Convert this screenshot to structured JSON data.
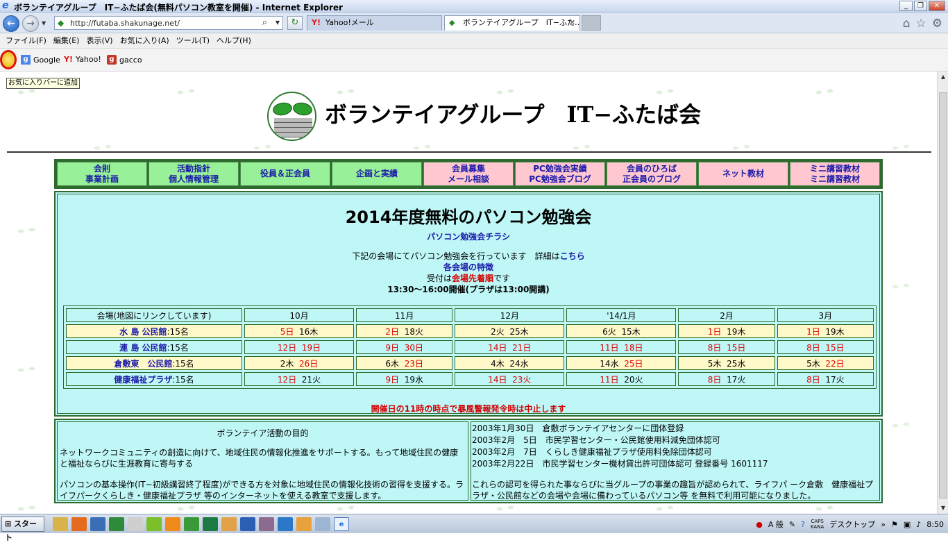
{
  "window": {
    "title": "ボランテイアグループ　IT−ふたば会(無料パソコン教室を開催) - Internet Explorer",
    "buttons": [
      "_",
      "❐",
      "✕"
    ]
  },
  "nav": {
    "back": "←",
    "forward": "→",
    "address": "http://futaba.shakunage.net/",
    "refresh": "↻",
    "tabs": [
      {
        "label": "Yahoo!メール",
        "icon": "Y!"
      },
      {
        "label": "ボランテイアグループ　IT−ふた…",
        "icon": "◆"
      }
    ],
    "tools": [
      "home-icon",
      "star-icon",
      "gear-icon"
    ]
  },
  "menu": [
    "ファイル(F)",
    "編集(E)",
    "表示(V)",
    "お気に入り(A)",
    "ツール(T)",
    "ヘルプ(H)"
  ],
  "favorites": {
    "links": [
      {
        "label": "Google",
        "icon": "g"
      },
      {
        "label": "Yahoo!",
        "icon": "Y!"
      },
      {
        "label": "gacco",
        "icon": "g"
      }
    ],
    "tooltip": "お気に入りバーに追加"
  },
  "site": {
    "title": "ボランテイアグループ　IT−ふたば会",
    "nav": [
      {
        "l1": "会則",
        "l2": "事業計画",
        "color": "green"
      },
      {
        "l1": "活動指針",
        "l2": "個人情報管理",
        "color": "green"
      },
      {
        "l1": "役員＆正会員",
        "l2": "",
        "color": "green"
      },
      {
        "l1": "企画と実績",
        "l2": "",
        "color": "green"
      },
      {
        "l1": "会員募集",
        "l2": "メール相談",
        "color": "pink"
      },
      {
        "l1": "PC勉強会実績",
        "l2": "PC勉強会ブログ",
        "color": "pink"
      },
      {
        "l1": "会員のひろば",
        "l2": "正会員のブログ",
        "color": "pink"
      },
      {
        "l1": "ネット教材",
        "l2": "",
        "color": "pink"
      },
      {
        "l1": "ミニ講習教材",
        "l2": "ミニ講習教材",
        "color": "pink"
      }
    ],
    "main": {
      "title": "2014年度無料のパソコン勉強会",
      "flyer": "パソコン勉強会チラシ",
      "intro": "下記の会場にてパソコン勉強会を行っています　詳細は",
      "intro_link": "こちら",
      "features": "各会場の特徴",
      "reception_pre": "受付は",
      "reception_em": "会場先着順",
      "reception_post": "です",
      "hours": "13:30〜16:00開催(プラザは13:00開講)",
      "warning": "開催日の11時の時点で暴風警報発令時は中止します"
    },
    "schedule": {
      "header": [
        "会場(地図にリンクしています)",
        "10月",
        "11月",
        "12月",
        "'14/1月",
        "2月",
        "3月"
      ],
      "rows": [
        {
          "venue": "水 島 公民館",
          "cap": ":15名",
          "style": "yellow",
          "cells": [
            [
              [
                "5日",
                "r"
              ],
              [
                "16木",
                "b"
              ]
            ],
            [
              [
                "2日",
                "r"
              ],
              [
                "18火",
                "b"
              ]
            ],
            [
              [
                "2火",
                "b"
              ],
              [
                "25木",
                "b"
              ]
            ],
            [
              [
                "6火",
                "b"
              ],
              [
                "15木",
                "b"
              ]
            ],
            [
              [
                "1日",
                "r"
              ],
              [
                "19木",
                "b"
              ]
            ],
            [
              [
                "1日",
                "r"
              ],
              [
                "19木",
                "b"
              ]
            ]
          ]
        },
        {
          "venue": "連 島 公民館",
          "cap": ":15名",
          "style": "cyan",
          "cells": [
            [
              [
                "12日",
                "r"
              ],
              [
                "19日",
                "r"
              ]
            ],
            [
              [
                "9日",
                "r"
              ],
              [
                "30日",
                "r"
              ]
            ],
            [
              [
                "14日",
                "r"
              ],
              [
                "21日",
                "r"
              ]
            ],
            [
              [
                "11日",
                "r"
              ],
              [
                "18日",
                "r"
              ]
            ],
            [
              [
                "8日",
                "r"
              ],
              [
                "15日",
                "r"
              ]
            ],
            [
              [
                "8日",
                "r"
              ],
              [
                "15日",
                "r"
              ]
            ]
          ]
        },
        {
          "venue": "倉敷東　公民館",
          "cap": ":15名",
          "style": "yellow",
          "cells": [
            [
              [
                "2木",
                "b"
              ],
              [
                "26日",
                "r"
              ]
            ],
            [
              [
                "6木",
                "b"
              ],
              [
                "23日",
                "r"
              ]
            ],
            [
              [
                "4木",
                "b"
              ],
              [
                "24水",
                "b"
              ]
            ],
            [
              [
                "14水",
                "b"
              ],
              [
                "25日",
                "r"
              ]
            ],
            [
              [
                "5木",
                "b"
              ],
              [
                "25水",
                "b"
              ]
            ],
            [
              [
                "5木",
                "b"
              ],
              [
                "22日",
                "r"
              ]
            ]
          ]
        },
        {
          "venue": "健康福祉プラザ",
          "cap": ":15名",
          "style": "cyan",
          "cells": [
            [
              [
                "12日",
                "r"
              ],
              [
                "21火",
                "b"
              ]
            ],
            [
              [
                "9日",
                "r"
              ],
              [
                "19水",
                "b"
              ]
            ],
            [
              [
                "14日",
                "r"
              ],
              [
                "23火",
                "r"
              ]
            ],
            [
              [
                "11日",
                "r"
              ],
              [
                "20火",
                "b"
              ]
            ],
            [
              [
                "8日",
                "r"
              ],
              [
                "17火",
                "b"
              ]
            ],
            [
              [
                "8日",
                "r"
              ],
              [
                "17火",
                "b"
              ]
            ]
          ]
        }
      ]
    },
    "purpose": {
      "heading": "ボランテイア活動の目的",
      "p1": "ネットワークコミュニティの創造に向けて、地域住民の情報化推進をサポートする。もって地域住民の健康と福祉ならびに生涯教育に寄与する",
      "p2": "パソコンの基本操作(IT−初級講習終了程度)ができる方を対象に地域住民の情報化技術の習得を支援する。ライフパークくらしき・健康福祉プラザ 等のインターネットを使える教室で支援します。"
    },
    "history": {
      "items": [
        "2003年1月30日　倉敷ボランテイアセンターに団体登録",
        "2003年2月　5日　市民学習センター・公民館使用料減免団体認可",
        "2003年2月　7日　くらしき健康福祉プラザ使用料免除団体認可",
        "2003年2月22日　市民学習センター機材貸出許可団体認可  登録番号 1601117"
      ],
      "note": "これらの認可を得られた事ならびに当グループの事業の趣旨が認められて、ライフパ ーク倉敷　健康福祉プラザ・公民館などの会場や会場に備わっているパソコン等 を無料で利用可能になりました。"
    }
  },
  "taskbar": {
    "start": "スタート",
    "ime": "A 般",
    "caps": "CAPS",
    "kana": "KANA",
    "desktop": "デスクトップ",
    "clock": "8:50"
  }
}
